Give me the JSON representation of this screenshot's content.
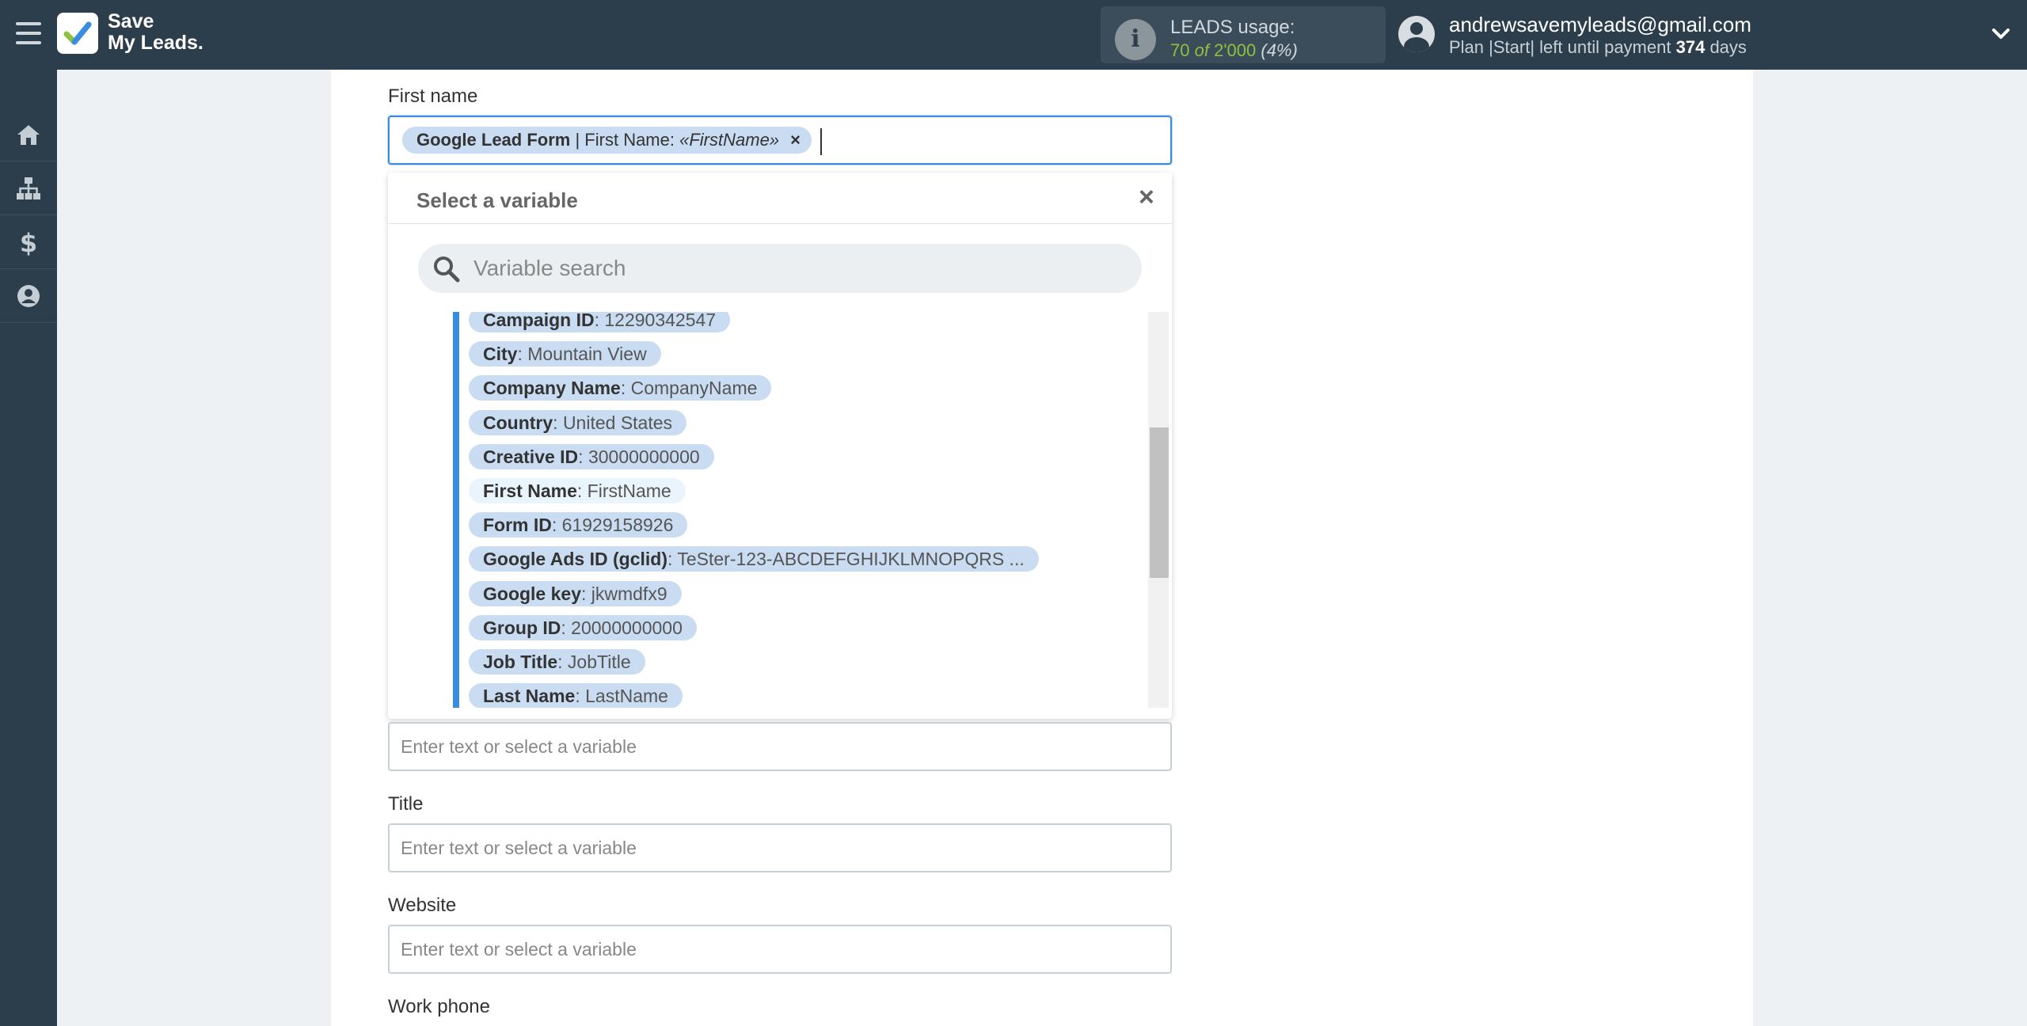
{
  "header": {
    "logo_line1": "Save",
    "logo_line2": "My Leads.",
    "usage_label": "LEADS usage:",
    "usage_used": "70",
    "usage_of": "of",
    "usage_total": "2'000",
    "usage_pct": "(4%)",
    "usage_fraction": 0.035,
    "email": "andrewsavemyleads@gmail.com",
    "plan_prefix": "Plan |Start| left until payment",
    "plan_days": "374",
    "plan_suffix": "days"
  },
  "sidebar": {
    "items": [
      {
        "name": "home-icon"
      },
      {
        "name": "sitemap-icon"
      },
      {
        "name": "dollar-icon"
      },
      {
        "name": "user-icon"
      }
    ]
  },
  "form": {
    "first_name_label": "First name",
    "first_name_chip": {
      "source": "Google Lead Form",
      "separator": "| First Name:",
      "value": "«FirstName»",
      "remove": "×"
    },
    "placeholder": "Enter text or select a variable",
    "title_label": "Title",
    "website_label": "Website",
    "work_phone_label": "Work phone"
  },
  "dropdown": {
    "title": "Select a variable",
    "close": "×",
    "search_placeholder": "Variable search",
    "variables": [
      {
        "key": "Campaign ID",
        "value": ": 12290342547"
      },
      {
        "key": "City",
        "value": ": Mountain View"
      },
      {
        "key": "Company Name",
        "value": ": CompanyName"
      },
      {
        "key": "Country",
        "value": ": United States"
      },
      {
        "key": "Creative ID",
        "value": ": 30000000000"
      },
      {
        "key": "First Name",
        "value": ": FirstName"
      },
      {
        "key": "Form ID",
        "value": ": 61929158926"
      },
      {
        "key": "Google Ads ID (gclid)",
        "value": ": TeSter-123-ABCDEFGHIJKLMNOPQRS ..."
      },
      {
        "key": "Google key",
        "value": ": jkwmdfx9"
      },
      {
        "key": "Group ID",
        "value": ": 20000000000"
      },
      {
        "key": "Job Title",
        "value": ": JobTitle"
      },
      {
        "key": "Last Name",
        "value": ": LastName"
      }
    ]
  }
}
